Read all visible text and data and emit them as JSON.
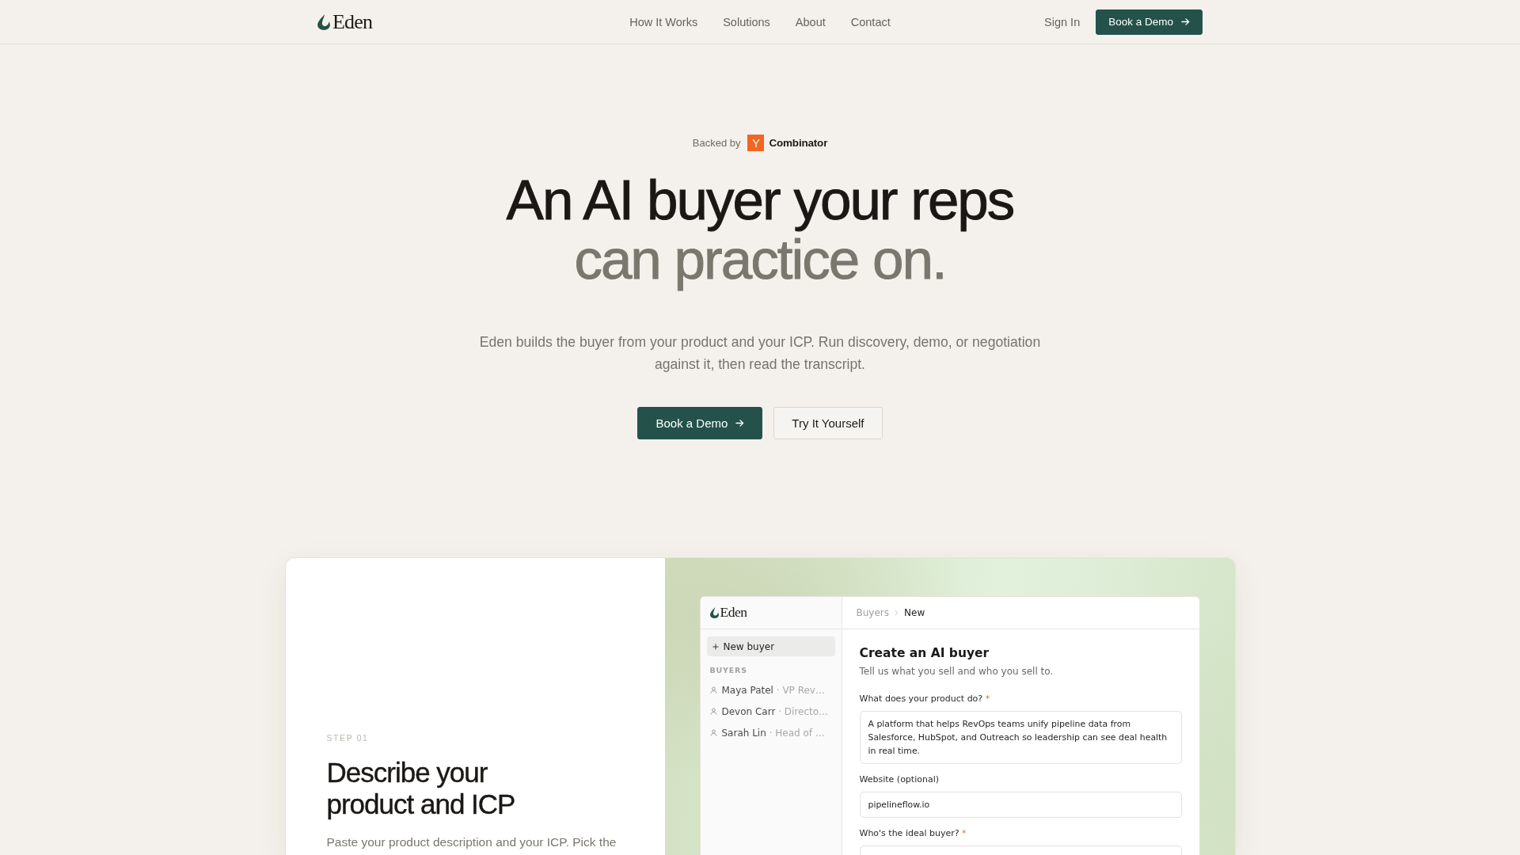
{
  "nav": {
    "logo": "Eden",
    "links": [
      "How It Works",
      "Solutions",
      "About",
      "Contact"
    ],
    "sign_in": "Sign In",
    "cta": "Book a Demo"
  },
  "hero": {
    "backed_by": {
      "prefix": "Backed by",
      "logo_letter": "Y",
      "name": "Combinator"
    },
    "headline": [
      {
        "text": "An AI buyer your reps",
        "muted": false
      },
      {
        "text": "can practice on.",
        "muted": true
      }
    ],
    "description": "Eden builds the buyer from your product and your ICP. Run discovery, demo, or negotiation against it, then read the transcript.",
    "buttons": [
      {
        "label": "Book a Demo",
        "kind": "primary"
      },
      {
        "label": "Try It Yourself",
        "kind": "secondary"
      }
    ]
  },
  "feature": {
    "step": "STEP 01",
    "title": "Describe your product and ICP",
    "description": "Paste your product description and your ICP. Pick the",
    "app": {
      "logo": "Eden",
      "new_button": "New buyer",
      "section_label": "BUYERS",
      "buyers": [
        {
          "name": "Maya Patel",
          "detail": "· VP Rev…"
        },
        {
          "name": "Devon Carr",
          "detail": "· Directo…"
        },
        {
          "name": "Sarah Lin",
          "detail": "· Head of …"
        }
      ],
      "breadcrumb": [
        {
          "label": "Buyers",
          "current": false
        },
        {
          "label": "New",
          "current": true
        }
      ],
      "form": {
        "title": "Create an AI buyer",
        "subtitle": "Tell us what you sell and who you sell to.",
        "fields": [
          {
            "label": "What does your product do?",
            "required_mark": "*",
            "kind": "textarea",
            "value": "A platform that helps RevOps teams unify pipeline data from Salesforce, HubSpot, and Outreach so leadership can see deal health in real time."
          },
          {
            "label": "Website (optional)",
            "kind": "input",
            "value": "pipelineflow.io"
          },
          {
            "label": "Who's the ideal buyer?",
            "required_mark": "*",
            "kind": "input"
          }
        ]
      }
    }
  }
}
